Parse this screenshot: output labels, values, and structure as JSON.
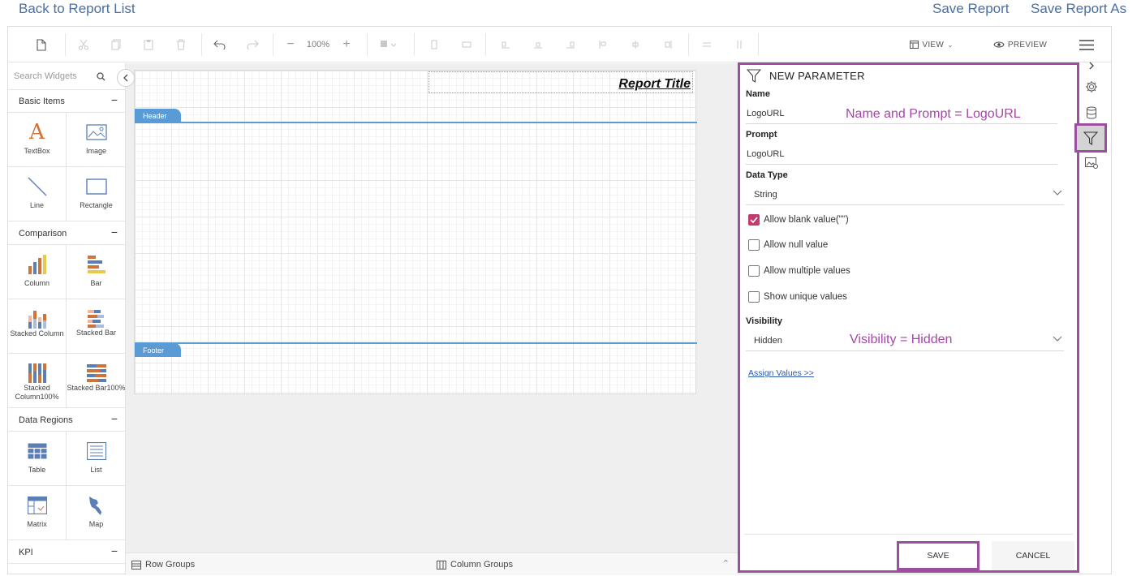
{
  "nav": {
    "back": "Back to Report List",
    "save": "Save Report",
    "save_as": "Save Report As"
  },
  "toolbar": {
    "zoom": "100%",
    "view": "VIEW",
    "preview": "PREVIEW"
  },
  "widgets": {
    "search_placeholder": "Search Widgets",
    "categories": [
      {
        "label": "Basic Items",
        "items": [
          "TextBox",
          "Image",
          "Line",
          "Rectangle"
        ]
      },
      {
        "label": "Comparison",
        "items": [
          "Column",
          "Bar",
          "Stacked Column",
          "Stacked Bar",
          "Stacked Column100%",
          "Stacked Bar100%"
        ]
      },
      {
        "label": "Data Regions",
        "items": [
          "Table",
          "List",
          "Matrix",
          "Map"
        ]
      },
      {
        "label": "KPI",
        "items": []
      }
    ]
  },
  "canvas": {
    "title": "Report Title",
    "header": "Header",
    "footer": "Footer"
  },
  "bottom": {
    "row_groups": "Row Groups",
    "column_groups": "Column Groups"
  },
  "param": {
    "heading": "NEW PARAMETER",
    "name_label": "Name",
    "name_value": "LogoURL",
    "prompt_label": "Prompt",
    "prompt_value": "LogoURL",
    "datatype_label": "Data Type",
    "datatype_value": "String",
    "checkboxes": [
      {
        "label": "Allow blank value(\"\")",
        "checked": true
      },
      {
        "label": "Allow null value",
        "checked": false
      },
      {
        "label": "Allow multiple values",
        "checked": false
      },
      {
        "label": "Show unique values",
        "checked": false
      }
    ],
    "visibility_label": "Visibility",
    "visibility_value": "Hidden",
    "assign": "Assign Values >>",
    "save": "SAVE",
    "cancel": "CANCEL"
  },
  "annotations": {
    "name_prompt": "Name and Prompt = LogoURL",
    "visibility": "Visibility = Hidden"
  },
  "colors": {
    "accent_purple": "#9c4fa0",
    "link_blue": "#4a6fa5",
    "band_blue": "#5b9bd5",
    "checkbox_checked": "#c23b6e"
  }
}
